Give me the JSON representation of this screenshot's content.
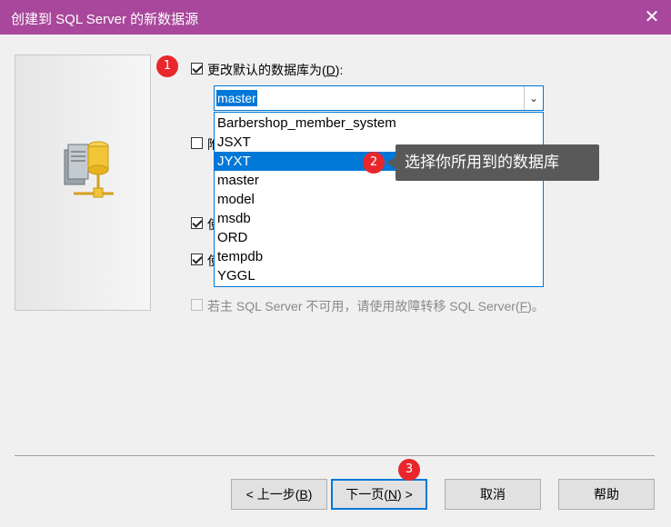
{
  "window": {
    "title": "创建到 SQL Server 的新数据源",
    "close_label": "✕"
  },
  "options": {
    "change_default_db": {
      "label": "更改默认的数据库为(",
      "mnemonic": "D",
      "suffix": "):",
      "checked": true
    },
    "attach_db": {
      "label_partial": "附",
      "checked": false
    },
    "option_three": {
      "label_partial": "使",
      "checked": true
    },
    "option_four": {
      "label_partial": "使",
      "checked": true
    },
    "failover": {
      "label": "若主 SQL Server 不可用，请使用故障转移 SQL Server(",
      "mnemonic": "F",
      "suffix": ")。",
      "checked": false,
      "enabled": false
    }
  },
  "database_combo": {
    "selected_value": "master",
    "arrow": "⌄",
    "options": [
      "Barbershop_member_system",
      "JSXT",
      "JYXT",
      "master",
      "model",
      "msdb",
      "ORD",
      "tempdb",
      "YGGL"
    ],
    "highlighted": "JYXT"
  },
  "annotations": {
    "badge1": "1",
    "badge2": "2",
    "badge3": "3",
    "tooltip": "选择你所用到的数据库"
  },
  "buttons": {
    "back": {
      "label": "< 上一步(",
      "mnemonic": "B",
      "suffix": ")"
    },
    "next": {
      "label": "下一页(",
      "mnemonic": "N",
      "suffix": ") >"
    },
    "cancel": "取消",
    "help": "帮助"
  },
  "colors": {
    "titlebar": "#a8479b",
    "accent": "#0078d7",
    "badge": "#e8262c",
    "tooltip_bg": "#595959"
  }
}
